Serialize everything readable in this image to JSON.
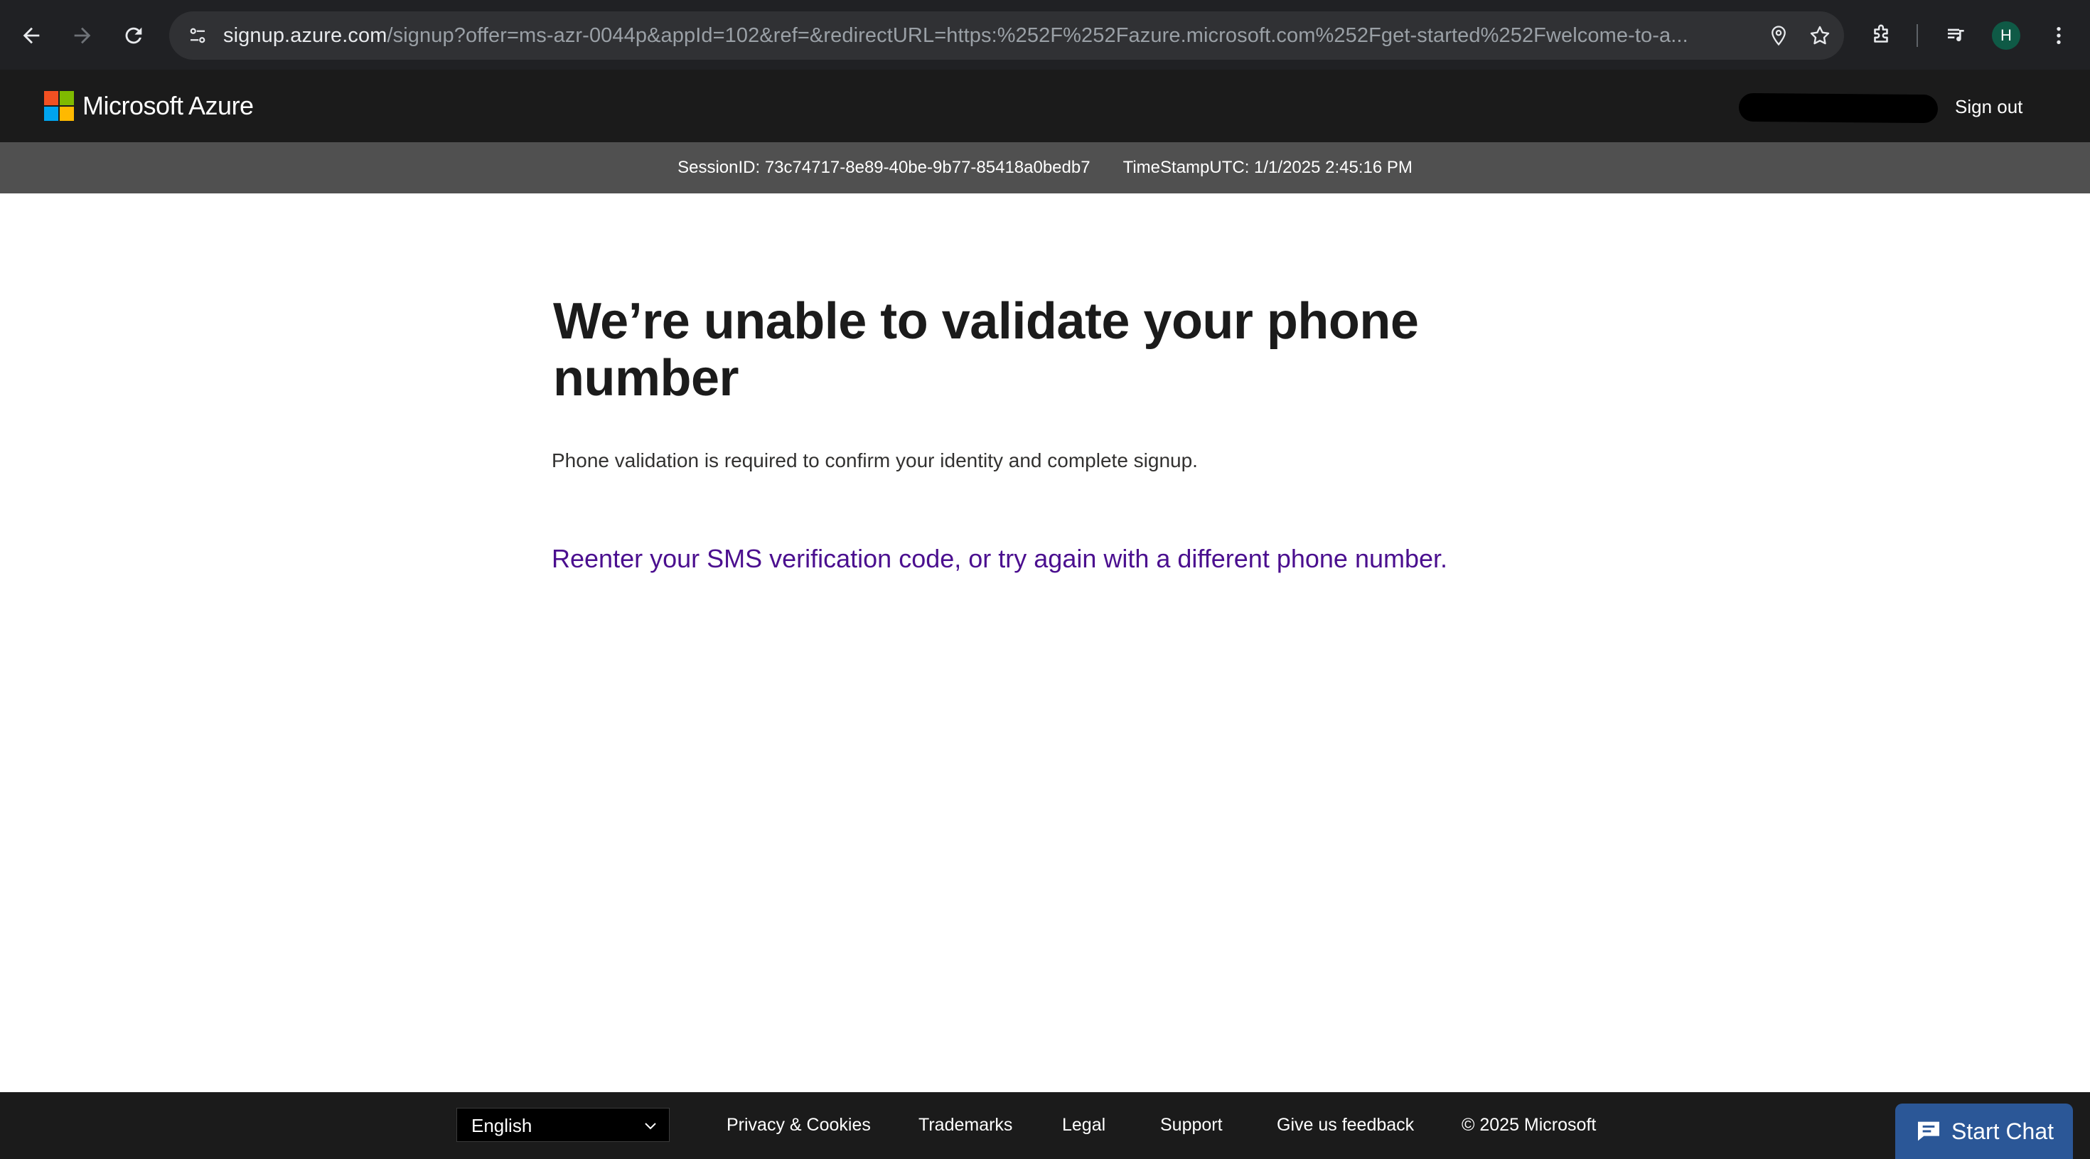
{
  "browser": {
    "url_host": "signup.azure.com",
    "url_path": "/signup?offer=ms-azr-0044p&appId=102&ref=&redirectURL=https:%252F%252Fazure.microsoft.com%252Fget-started%252Fwelcome-to-a...",
    "profile_initial": "H"
  },
  "header": {
    "brand": "Microsoft Azure",
    "sign_out": "Sign out",
    "logo_colors": [
      "#f25022",
      "#7fba00",
      "#00a4ef",
      "#ffb900"
    ]
  },
  "session": {
    "session_id": "SessionID: 73c74717-8e89-40be-9b77-85418a0bedb7",
    "timestamp": "TimeStampUTC: 1/1/2025 2:45:16 PM"
  },
  "main": {
    "title": "We’re unable to validate your phone number",
    "subtitle": "Phone validation is required to confirm your identity and complete signup.",
    "retry_link": "Reenter your SMS verification code, or try again with a different phone number."
  },
  "footer": {
    "language": "English",
    "links": [
      "Privacy & Cookies",
      "Trademarks",
      "Legal",
      "Support",
      "Give us feedback"
    ],
    "copyright": "© 2025 Microsoft"
  },
  "chat": {
    "label": "Start Chat"
  }
}
